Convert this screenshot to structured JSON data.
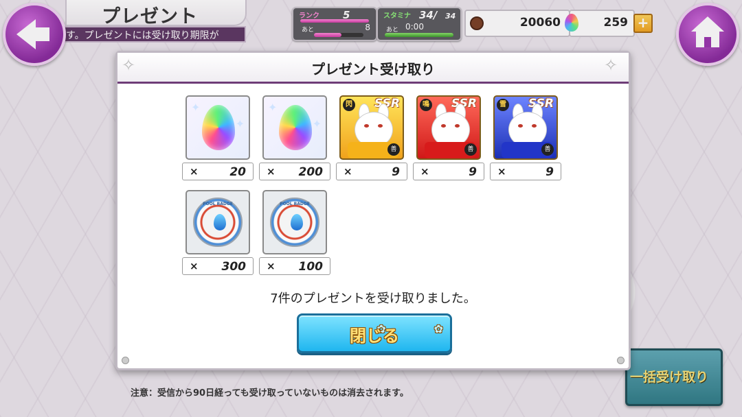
{
  "header": {
    "title": "プレゼント",
    "ticker": "す。プレゼントには受け取り期限が",
    "back_icon": "back-arrow-icon",
    "home_icon": "home-icon"
  },
  "status": {
    "rank_label": "ランク",
    "rank_value": "5",
    "rank_next_label": "あと",
    "rank_next_value": "8",
    "rank_progress": 0.55,
    "stamina_label": "スタミナ",
    "stamina_value": "34/",
    "stamina_max": "34",
    "stamina_next_label": "あと",
    "stamina_time": "0:00",
    "stamina_progress": 1.0,
    "coins": "20060",
    "gems": "259",
    "plus_label": "+"
  },
  "modal": {
    "title": "プレゼント受け取り",
    "items": [
      {
        "type": "gem",
        "x_label": "×",
        "count": "20"
      },
      {
        "type": "gem",
        "x_label": "×",
        "count": "200"
      },
      {
        "type": "character",
        "color": "yellow",
        "rarity": "SSR",
        "attr": "閃",
        "badge": "善",
        "x_label": "×",
        "count": "9"
      },
      {
        "type": "character",
        "color": "red",
        "rarity": "SSR",
        "attr": "鳴",
        "badge": "善",
        "x_label": "×",
        "count": "9"
      },
      {
        "type": "character",
        "color": "blue",
        "rarity": "SSR",
        "attr": "雪",
        "badge": "善",
        "x_label": "×",
        "count": "9"
      },
      {
        "type": "badge",
        "medal_text": "POOL BADGE",
        "x_label": "×",
        "count": "300"
      },
      {
        "type": "badge",
        "medal_text": "POOL BADGE",
        "x_label": "×",
        "count": "100"
      }
    ],
    "result_message": "7件のプレゼントを受け取りました。",
    "close_label": "閉じる"
  },
  "footer": {
    "notice": "注意：受信から90日経っても受け取っていないものは消去されます。",
    "bulk_receive_label": "一括受け取り"
  },
  "colors": {
    "accent_purple": "#8a2a9f",
    "close_button": "#1fb6ef",
    "header_line": "#6e3d78"
  }
}
